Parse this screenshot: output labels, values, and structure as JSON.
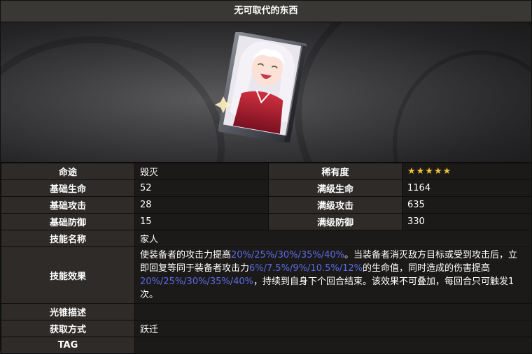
{
  "title": "无可取代的东西",
  "rows": {
    "path_label": "命途",
    "path_value": "毁灭",
    "rarity_label": "稀有度",
    "rarity_stars": "★★★★★",
    "base_hp_label": "基础生命",
    "base_hp_value": "52",
    "max_hp_label": "满级生命",
    "max_hp_value": "1164",
    "base_atk_label": "基础攻击",
    "base_atk_value": "28",
    "max_atk_label": "满级攻击",
    "max_atk_value": "635",
    "base_def_label": "基础防御",
    "base_def_value": "15",
    "max_def_label": "满级防御",
    "max_def_value": "330",
    "skill_name_label": "技能名称",
    "skill_name_value": "家人",
    "skill_effect_label": "技能效果",
    "skill_effect": {
      "p1": "使装备者的攻击力提高",
      "v1": "20%/25%/30%/35%/40%",
      "p2": "。当装备者消灭敌方目标或受到攻击后，立即回复等同于装备者攻击力",
      "v2": "6%/7.5%/9%/10.5%/12%",
      "p3": "的生命值，同时造成的伤害提高",
      "v3": "20%/25%/30%/35%/40%",
      "p4": "，持续到自身下个回合结束。该效果不可叠加，每回合只可触发1次。"
    },
    "lore_label": "光锥描述",
    "lore_value": "",
    "obtain_label": "获取方式",
    "obtain_value": "跃迁",
    "tag_label": "TAG",
    "tag_value": ""
  },
  "colors": {
    "highlight": "#5b6be8",
    "star": "#f2c233"
  }
}
